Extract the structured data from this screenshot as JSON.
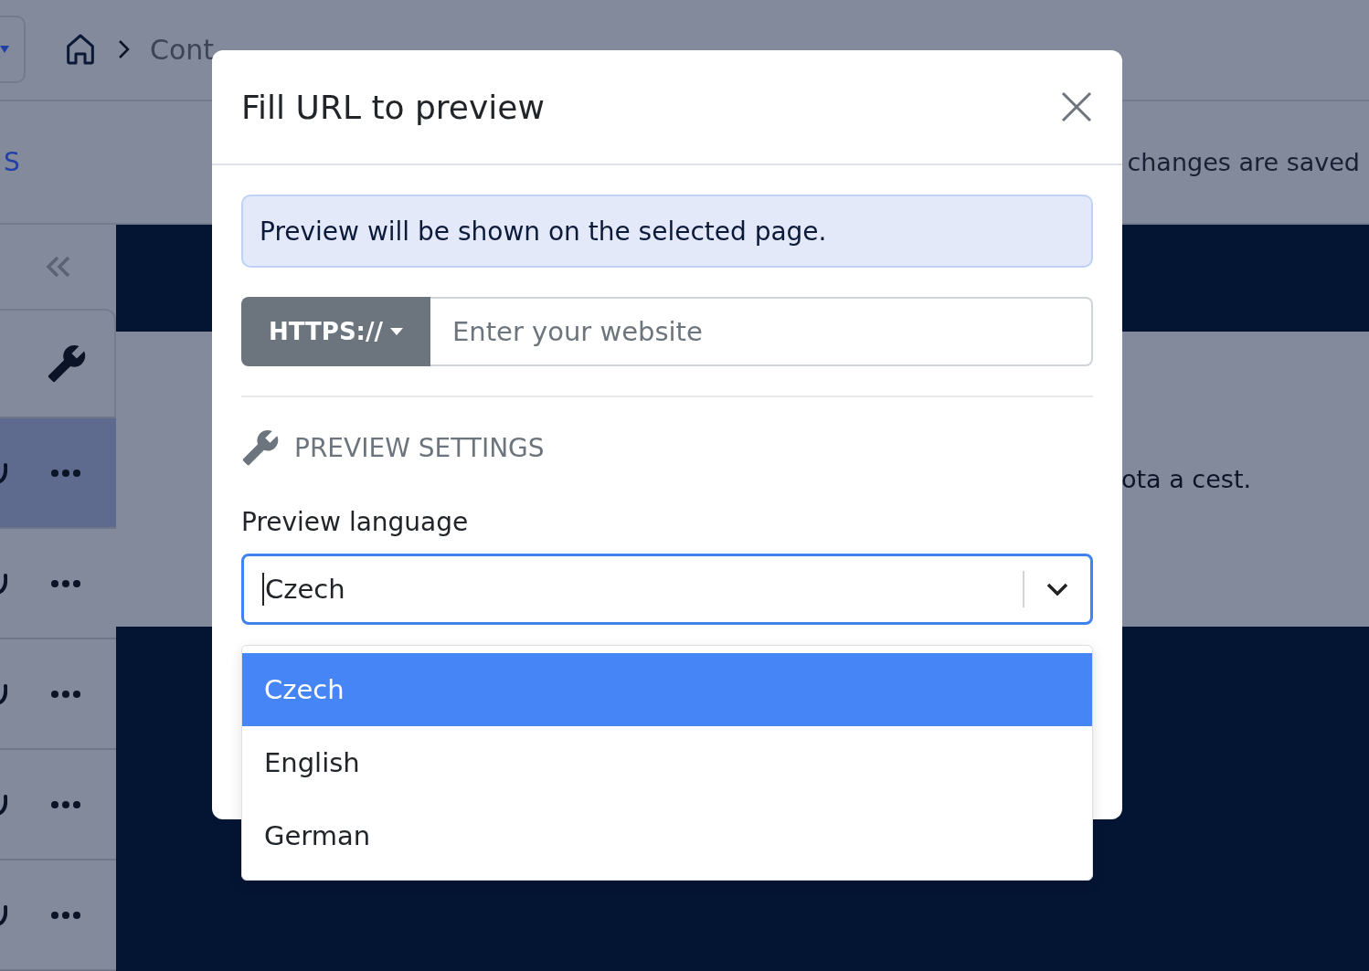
{
  "topbar": {
    "breadcrumb": [
      "Cont"
    ]
  },
  "toolbar": {
    "tab": "S",
    "status": "changes are saved"
  },
  "sidebar": {
    "rows": [
      {
        "selected": true
      },
      {
        "selected": false
      },
      {
        "selected": false
      },
      {
        "selected": false
      },
      {
        "selected": false
      }
    ]
  },
  "content": {
    "text": "ota a cest."
  },
  "modal": {
    "title": "Fill URL to preview",
    "info": "Preview will be shown on the selected page.",
    "url": {
      "scheme": "HTTPS://",
      "placeholder": "Enter your website"
    },
    "section": "PREVIEW SETTINGS",
    "language": {
      "label": "Preview language",
      "value": "Czech",
      "open": true,
      "options": [
        {
          "label": "Czech",
          "selected": true
        },
        {
          "label": "English",
          "selected": false
        },
        {
          "label": "German",
          "selected": false
        }
      ]
    }
  }
}
